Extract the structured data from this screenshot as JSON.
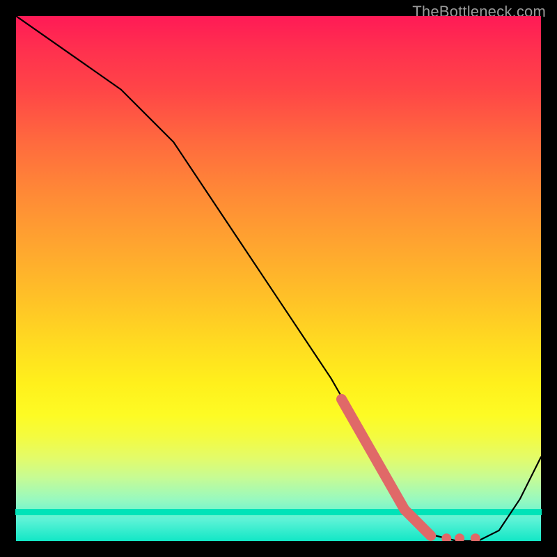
{
  "watermark": "TheBottleneck.com",
  "chart_data": {
    "type": "line",
    "title": "",
    "xlabel": "",
    "ylabel": "",
    "xlim": [
      0,
      100
    ],
    "ylim": [
      0,
      100
    ],
    "grid": false,
    "series": [
      {
        "name": "curve",
        "x": [
          0,
          10,
          20,
          26,
          30,
          40,
          50,
          60,
          64,
          68,
          72,
          76,
          80,
          84,
          88,
          92,
          96,
          100
        ],
        "y": [
          100,
          93,
          86,
          80,
          76,
          61,
          46,
          31,
          24,
          16,
          9,
          4,
          1,
          0,
          0,
          2,
          8,
          16
        ]
      }
    ],
    "highlight": {
      "name": "thick-band",
      "color": "#e06968",
      "points": [
        {
          "x": 62,
          "y": 27
        },
        {
          "x": 74,
          "y": 6
        },
        {
          "x": 78,
          "y": 2
        },
        {
          "x": 79,
          "y": 1
        }
      ],
      "dots": [
        {
          "x": 82,
          "y": 0.5
        },
        {
          "x": 84.5,
          "y": 0.5
        },
        {
          "x": 87.5,
          "y": 0.5
        }
      ]
    },
    "gradient_stops": [
      {
        "pos": 0,
        "color": "#ff1a56"
      },
      {
        "pos": 14,
        "color": "#ff4547"
      },
      {
        "pos": 34,
        "color": "#ff8a36"
      },
      {
        "pos": 54,
        "color": "#ffc227"
      },
      {
        "pos": 76,
        "color": "#fdfb24"
      },
      {
        "pos": 92,
        "color": "#99f9be"
      },
      {
        "pos": 100,
        "color": "#12e7c6"
      }
    ]
  }
}
